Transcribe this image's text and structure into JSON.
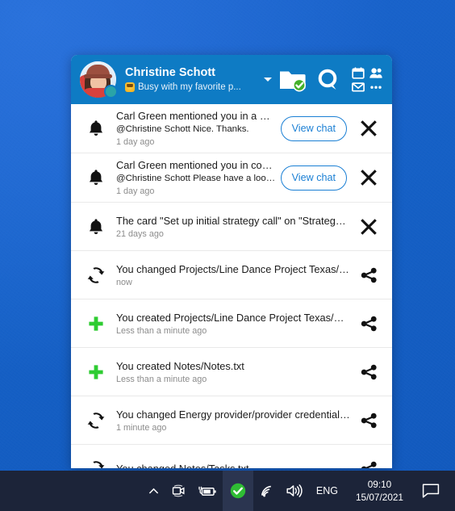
{
  "desktop": {
    "background_color": "#1560c6"
  },
  "panel": {
    "header": {
      "user_name": "Christine Schott",
      "status_text": "Busy with my favorite p...",
      "status_emoji": "grin-emoji",
      "presence": "busy",
      "avatar_alt": "Christine Schott",
      "chevron": "chevron-down-icon",
      "icons": [
        {
          "name": "folder-sync-icon",
          "label": "Files"
        },
        {
          "name": "search-icon",
          "label": "Search"
        },
        {
          "name": "calendar-icon",
          "label": "Calendar"
        },
        {
          "name": "contacts-icon",
          "label": "Contacts"
        },
        {
          "name": "mail-icon",
          "label": "Mail"
        },
        {
          "name": "more-icon",
          "label": "More"
        }
      ],
      "accent_color": "#0e7bc4"
    },
    "notifications": [
      {
        "icon": "bell-icon",
        "title": "Carl Green mentioned you in a private...",
        "subtitle": "@Christine Schott Nice. Thanks.",
        "time": "1 day ago",
        "button": "View chat",
        "action": "close-icon"
      },
      {
        "icon": "bell-icon",
        "title": "Carl Green mentioned you in conversa...",
        "subtitle": "@Christine Schott Please have a look :)",
        "time": "1 day ago",
        "button": "View chat",
        "action": "close-icon"
      },
      {
        "icon": "bell-icon",
        "title": "The card \"Set up initial strategy call\" on \"Strategy d...",
        "subtitle": "",
        "time": "21 days ago",
        "button": "",
        "action": "close-icon"
      },
      {
        "icon": "sync-icon",
        "title": "You changed Projects/Line Dance Project Texas/Gui...",
        "subtitle": "",
        "time": "now",
        "button": "",
        "action": "share-icon"
      },
      {
        "icon": "plus-icon",
        "title": "You created Projects/Line Dance Project Texas/Guid...",
        "subtitle": "",
        "time": "Less than a minute ago",
        "button": "",
        "action": "share-icon"
      },
      {
        "icon": "plus-icon",
        "title": "You created Notes/Notes.txt",
        "subtitle": "",
        "time": "Less than a minute ago",
        "button": "",
        "action": "share-icon"
      },
      {
        "icon": "sync-icon",
        "title": "You changed Energy provider/provider credentials.md",
        "subtitle": "",
        "time": "1 minute ago",
        "button": "",
        "action": "share-icon"
      },
      {
        "icon": "sync-icon",
        "title": "You changed Notes/Tasks.txt",
        "subtitle": "",
        "time": "",
        "button": "",
        "action": "share-icon"
      }
    ]
  },
  "taskbar": {
    "background_color": "#1c2439",
    "show_hidden_icons": "show-hidden-icons-chevron",
    "tray": [
      {
        "name": "camera-icon"
      },
      {
        "name": "battery-charging-icon"
      },
      {
        "name": "seafile-status-icon",
        "highlighted": true
      },
      {
        "name": "wifi-icon"
      },
      {
        "name": "volume-icon"
      }
    ],
    "language": "ENG",
    "clock_time": "09:10",
    "clock_date": "15/07/2021",
    "action_center": "action-center-icon"
  }
}
